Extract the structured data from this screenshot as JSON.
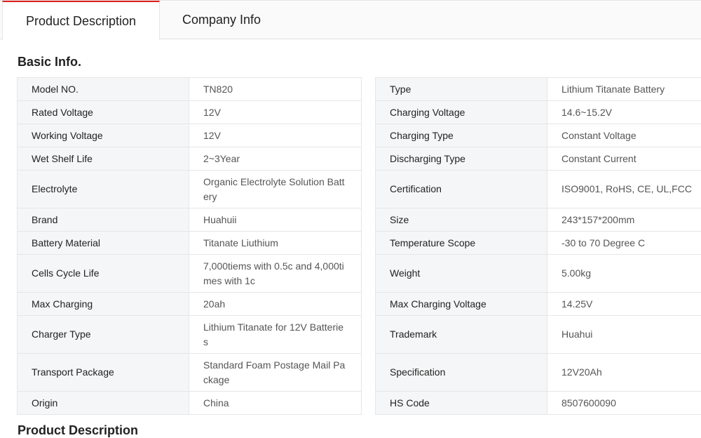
{
  "tabs": [
    {
      "label": "Product Description",
      "active": true
    },
    {
      "label": "Company Info",
      "active": false
    }
  ],
  "accent_color": "#e02020",
  "section_title": "Basic Info.",
  "left_rows": [
    {
      "key": "Model NO.",
      "value": "TN820"
    },
    {
      "key": "Rated Voltage",
      "value": "12V"
    },
    {
      "key": "Working Voltage",
      "value": "12V"
    },
    {
      "key": "Wet Shelf Life",
      "value": "2~3Year"
    },
    {
      "key": "Electrolyte",
      "value": "Organic Electrolyte Solution Battery"
    },
    {
      "key": "Brand",
      "value": "Huahuii"
    },
    {
      "key": "Battery Material",
      "value": "Titanate Liuthium"
    },
    {
      "key": "Cells Cycle Life",
      "value": "7,000tiems with 0.5c and 4,000times with 1c"
    },
    {
      "key": "Max Charging",
      "value": "20ah"
    },
    {
      "key": "Charger Type",
      "value": "Lithium Titanate for 12V Batteries"
    },
    {
      "key": "Transport Package",
      "value": "Standard Foam Postage Mail Package"
    },
    {
      "key": "Origin",
      "value": "China"
    }
  ],
  "right_rows": [
    {
      "key": "Type",
      "value": "Lithium Titanate Battery"
    },
    {
      "key": "Charging Voltage",
      "value": "14.6~15.2V"
    },
    {
      "key": "Charging Type",
      "value": "Constant Voltage"
    },
    {
      "key": "Discharging Type",
      "value": "Constant Current"
    },
    {
      "key": "Certification",
      "value": "ISO9001, RoHS, CE, UL,FCC"
    },
    {
      "key": "Size",
      "value": "243*157*200mm"
    },
    {
      "key": "Temperature Scope",
      "value": "-30 to 70 Degree C"
    },
    {
      "key": "Weight",
      "value": "5.00kg"
    },
    {
      "key": "Max Charging Voltage",
      "value": "14.25V"
    },
    {
      "key": "Trademark",
      "value": "Huahui"
    },
    {
      "key": "Specification",
      "value": "12V20Ah"
    },
    {
      "key": "HS Code",
      "value": "8507600090"
    }
  ],
  "next_section_title": "Product Description"
}
